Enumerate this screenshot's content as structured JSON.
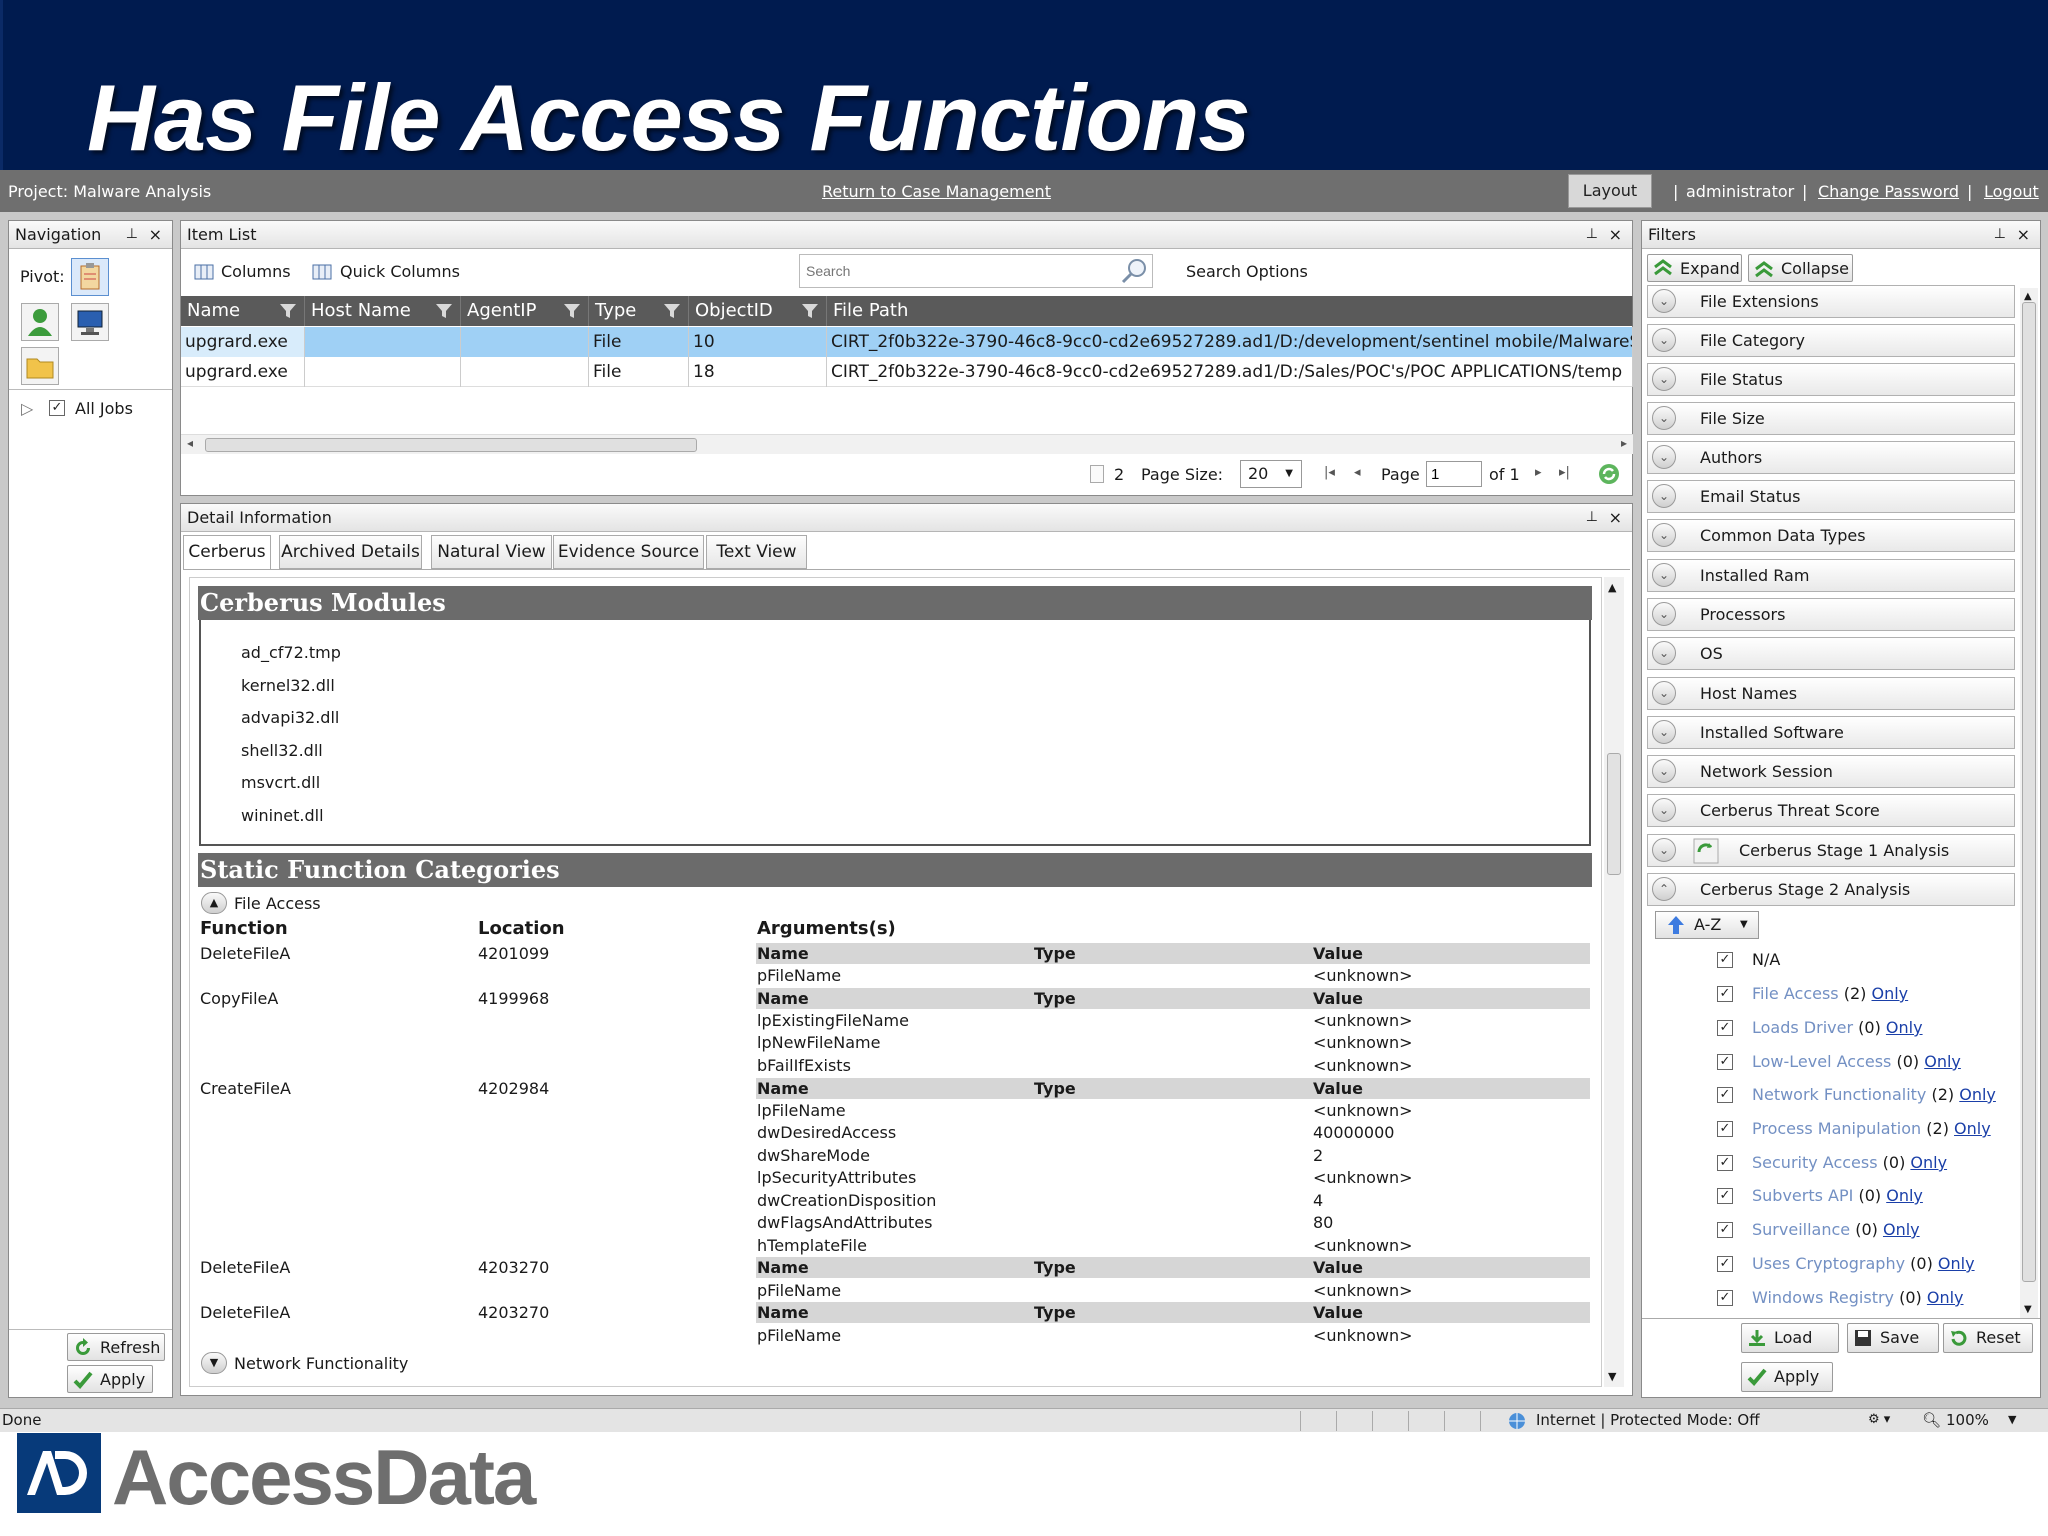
{
  "slide": {
    "title": "Has File Access Functions"
  },
  "appbar": {
    "project": "Project: Malware Analysis",
    "return_link": "Return to Case Management",
    "layout": "Layout",
    "sep1": "|",
    "user": "administrator",
    "sep2": "|",
    "change_password": "Change Password",
    "sep3": "|",
    "logout": "Logout"
  },
  "navigation": {
    "title": "Navigation",
    "pin": "⊥",
    "close": "×",
    "pivot_label": "Pivot:",
    "all_jobs": "All Jobs",
    "refresh": "Refresh",
    "apply": "Apply"
  },
  "item_list": {
    "title": "Item List",
    "columns_btn": "Columns",
    "quick_columns_btn": "Quick Columns",
    "search_placeholder": "Search",
    "search_options": "Search Options",
    "headers": [
      "Name",
      "Host Name",
      "AgentIP",
      "Type",
      "ObjectID",
      "File Path"
    ],
    "rows": [
      {
        "name": "upgrard.exe",
        "host": "",
        "agent": "",
        "type": "File",
        "objectid": "10",
        "path": "CIRT_2f0b322e-3790-46c8-9cc0-cd2e69527289.ad1/D:/development/sentinel mobile/MalwareS"
      },
      {
        "name": "upgrard.exe",
        "host": "",
        "agent": "",
        "type": "File",
        "objectid": "18",
        "path": "CIRT_2f0b322e-3790-46c8-9cc0-cd2e69527289.ad1/D:/Sales/POC's/POC APPLICATIONS/temp"
      }
    ],
    "count": "2",
    "page_size_label": "Page Size:",
    "page_size": "20",
    "page_label": "Page",
    "page": "1",
    "of": "of 1"
  },
  "detail": {
    "title": "Detail Information",
    "tabs": [
      "Cerberus",
      "Archived Details",
      "Natural View",
      "Evidence Source",
      "Text View"
    ],
    "modules_title": "Cerberus Modules",
    "modules": [
      "ad_cf72.tmp",
      "kernel32.dll",
      "advapi32.dll",
      "shell32.dll",
      "msvcrt.dll",
      "wininet.dll"
    ],
    "static_title": "Static Function Categories",
    "group_file_access": "File Access",
    "col_function": "Function",
    "col_location": "Location",
    "col_arguments": "Arguments(s)",
    "arg_name": "Name",
    "arg_type": "Type",
    "arg_value": "Value",
    "functions": [
      {
        "function": "DeleteFileA",
        "location": "4201099",
        "args": [
          [
            "pFileName",
            "<unknown>"
          ]
        ]
      },
      {
        "function": "CopyFileA",
        "location": "4199968",
        "args": [
          [
            "lpExistingFileName",
            "<unknown>"
          ],
          [
            "lpNewFileName",
            "<unknown>"
          ],
          [
            "bFailIfExists",
            "<unknown>"
          ]
        ]
      },
      {
        "function": "CreateFileA",
        "location": "4202984",
        "args": [
          [
            "lpFileName",
            "<unknown>"
          ],
          [
            "dwDesiredAccess",
            "40000000"
          ],
          [
            "dwShareMode",
            "2"
          ],
          [
            "lpSecurityAttributes",
            "<unknown>"
          ],
          [
            "dwCreationDisposition",
            "4"
          ],
          [
            "dwFlagsAndAttributes",
            "80"
          ],
          [
            "hTemplateFile",
            "<unknown>"
          ]
        ]
      },
      {
        "function": "DeleteFileA",
        "location": "4203270",
        "args": [
          [
            "pFileName",
            "<unknown>"
          ]
        ]
      },
      {
        "function": "DeleteFileA",
        "location": "4203270",
        "args": [
          [
            "pFileName",
            "<unknown>"
          ]
        ]
      }
    ],
    "group_network": "Network Functionality"
  },
  "filters": {
    "title": "Filters",
    "expand": "Expand",
    "collapse": "Collapse",
    "items": [
      "File Extensions",
      "File Category",
      "File Status",
      "File Size",
      "Authors",
      "Email Status",
      "Common Data Types",
      "Installed Ram",
      "Processors",
      "OS",
      "Host Names",
      "Installed Software",
      "Network Session",
      "Cerberus Threat Score",
      "Cerberus Stage 1 Analysis",
      "Cerberus Stage 2 Analysis"
    ],
    "sort": "A-Z",
    "na": "N/A",
    "categories": [
      {
        "name": "File Access",
        "count": "(2)",
        "only": "Only"
      },
      {
        "name": "Loads Driver",
        "count": "(0)",
        "only": "Only"
      },
      {
        "name": "Low-Level Access",
        "count": "(0)",
        "only": "Only"
      },
      {
        "name": "Network Functionality",
        "count": "(2)",
        "only": "Only"
      },
      {
        "name": "Process Manipulation",
        "count": "(2)",
        "only": "Only"
      },
      {
        "name": "Security Access",
        "count": "(0)",
        "only": "Only"
      },
      {
        "name": "Subverts API",
        "count": "(0)",
        "only": "Only"
      },
      {
        "name": "Surveillance",
        "count": "(0)",
        "only": "Only"
      },
      {
        "name": "Uses Cryptography",
        "count": "(0)",
        "only": "Only"
      },
      {
        "name": "Windows Registry",
        "count": "(0)",
        "only": "Only"
      }
    ],
    "load": "Load",
    "save": "Save",
    "reset": "Reset",
    "apply": "Apply"
  },
  "statusbar": {
    "left": "Done",
    "zone": "Internet | Protected Mode: Off",
    "zoom": "100%"
  },
  "footer": {
    "brand": "AccessData",
    "brand_mark": "AD"
  },
  "colors": {
    "banner": "#001b4f",
    "grid_header": "#5a5a5a",
    "selected_row": "#9fd0f5",
    "section_header": "#6b6b6b",
    "link": "#1a3fa8"
  }
}
